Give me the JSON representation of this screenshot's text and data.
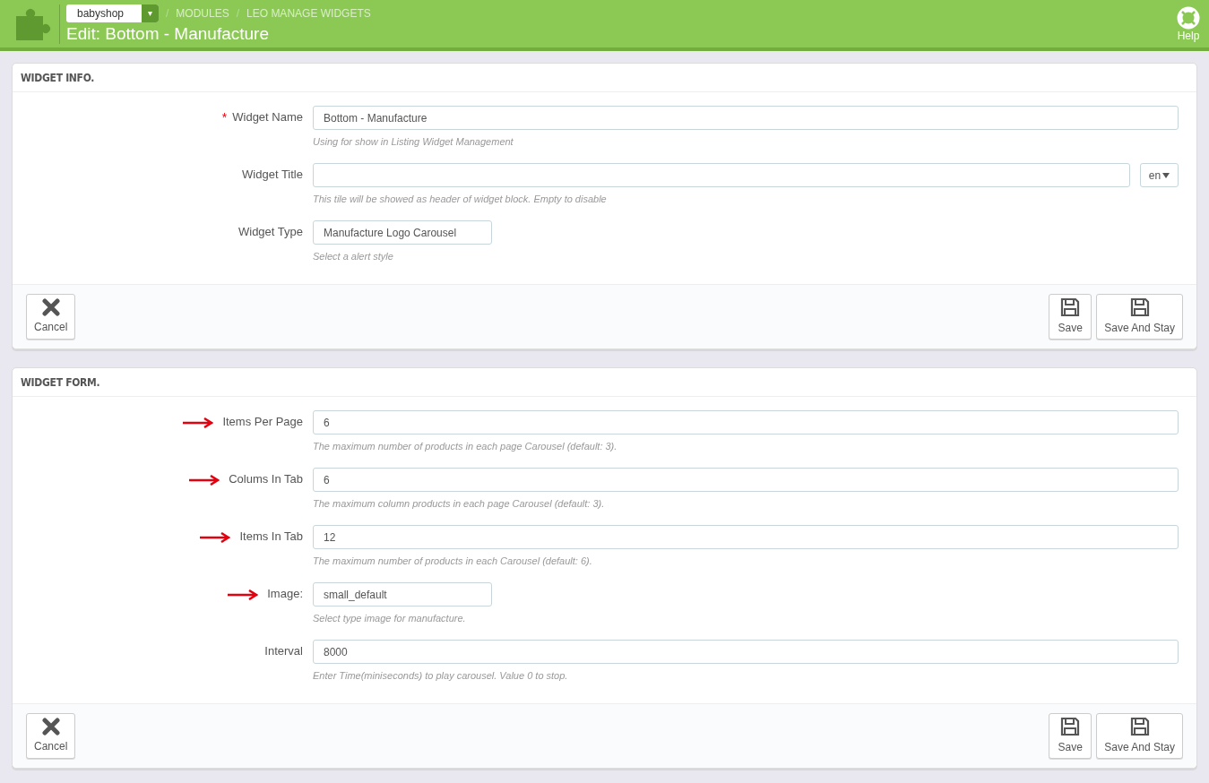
{
  "required_mark": "*",
  "header": {
    "separator": "/",
    "shop": "babyshop",
    "shop_caret": "▾",
    "breadcrumb": [
      "MODULES",
      "LEO MANAGE WIDGETS"
    ],
    "title": "Edit: Bottom - Manufacture",
    "help": "Help"
  },
  "panels": [
    {
      "title": "WIDGET INFO.",
      "fields": [
        {
          "kind": "text",
          "label": "Widget Name",
          "required": true,
          "marked": false,
          "value": "Bottom - Manufacture",
          "help": "Using for show in Listing Widget Management"
        },
        {
          "kind": "text_lang",
          "label": "Widget Title",
          "required": false,
          "marked": false,
          "lang": "en",
          "help": "This tile will be showed as header of widget block. Empty to disable"
        },
        {
          "kind": "select",
          "label": "Widget Type",
          "required": false,
          "marked": false,
          "value": "Manufacture Logo Carousel",
          "help": "Select a alert style"
        }
      ],
      "buttons": [
        {
          "kind": "cancel",
          "label": "Cancel"
        },
        {
          "kind": "save",
          "label": "Save"
        },
        {
          "kind": "save",
          "label": "Save And Stay"
        }
      ]
    },
    {
      "title": "WIDGET FORM.",
      "fields": [
        {
          "kind": "text",
          "label": "Items Per Page",
          "required": false,
          "marked": true,
          "value": "6",
          "help": "The maximum number of products in each page Carousel (default: 3)."
        },
        {
          "kind": "text",
          "label": "Colums In Tab",
          "required": false,
          "marked": true,
          "value": "6",
          "help": "The maximum column products in each page Carousel (default: 3)."
        },
        {
          "kind": "text",
          "label": "Items In Tab",
          "required": false,
          "marked": true,
          "value": "12",
          "help": "The maximum number of products in each Carousel (default: 6)."
        },
        {
          "kind": "select",
          "label": "Image:",
          "required": false,
          "marked": true,
          "value": "small_default",
          "help": "Select type image for manufacture."
        },
        {
          "kind": "text",
          "label": "Interval",
          "required": false,
          "marked": false,
          "value": "8000",
          "help": "Enter Time(miniseconds) to play carousel. Value 0 to stop."
        }
      ],
      "buttons": [
        {
          "kind": "cancel",
          "label": "Cancel"
        },
        {
          "kind": "save",
          "label": "Save"
        },
        {
          "kind": "save",
          "label": "Save And Stay"
        }
      ]
    }
  ]
}
